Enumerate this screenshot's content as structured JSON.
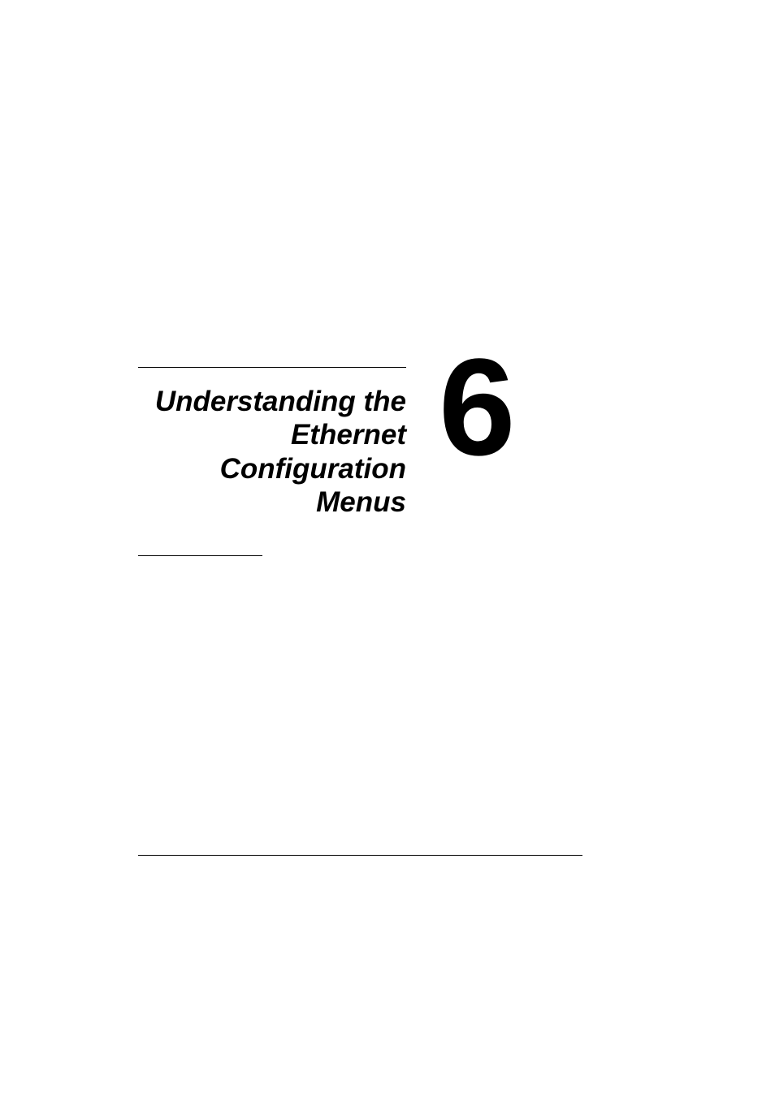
{
  "chapter": {
    "number": "6",
    "title": "Understanding the Ethernet Configuration Menus"
  }
}
